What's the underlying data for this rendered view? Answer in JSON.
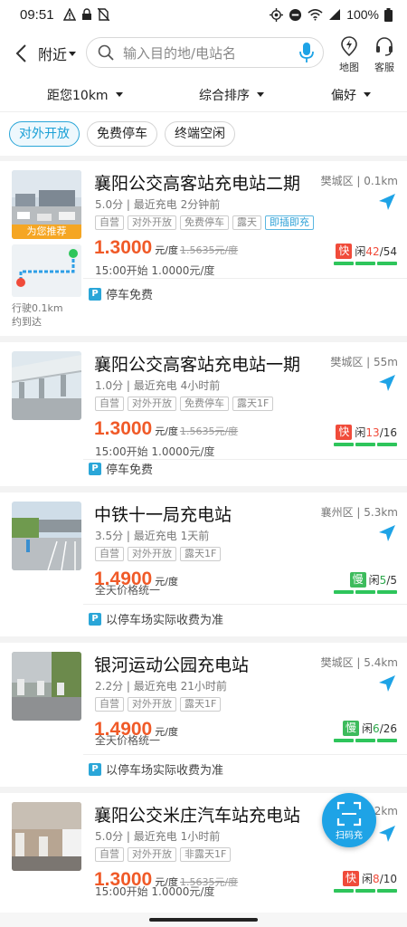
{
  "status_bar": {
    "time": "09:51",
    "battery": "100%"
  },
  "header": {
    "location": "附近",
    "search_placeholder": "输入目的地/电站名",
    "map_label": "地图",
    "service_label": "客服"
  },
  "filters": {
    "distance": "距您10km",
    "sort": "综合排序",
    "preference": "偏好"
  },
  "chips": [
    "对外开放",
    "免费停车",
    "终端空闲"
  ],
  "recommend_badge": "为您推荐",
  "drive_info": {
    "line1": "行驶0.1km",
    "line2": "约到达"
  },
  "stations": [
    {
      "name": "襄阳公交高客站充电站二期",
      "meta": "5.0分 | 最近充电 2分钟前",
      "distance": "樊城区 | 0.1km",
      "tags": [
        "自营",
        "对外开放",
        "免费停车",
        "露天",
        "即插即充"
      ],
      "price": "1.3000",
      "unit": "元/度",
      "old_price": "1.5635元/度",
      "sub": "15:00开始 1.0000元/度",
      "charger_type": "快",
      "free_label": "闲",
      "free": "42",
      "total": "/54",
      "parking": "停车免费"
    },
    {
      "name": "襄阳公交高客站充电站一期",
      "meta": "1.0分 | 最近充电 4小时前",
      "distance": "樊城区 | 55m",
      "tags": [
        "自营",
        "对外开放",
        "免费停车",
        "露天1F"
      ],
      "price": "1.3000",
      "unit": "元/度",
      "old_price": "1.5635元/度",
      "sub": "15:00开始 1.0000元/度",
      "charger_type": "快",
      "free_label": "闲",
      "free": "13",
      "total": "/16",
      "parking": "停车免费"
    },
    {
      "name": "中铁十一局充电站",
      "meta": "3.5分 | 最近充电 1天前",
      "distance": "襄州区 | 5.3km",
      "tags": [
        "自营",
        "对外开放",
        "露天1F"
      ],
      "price": "1.4900",
      "unit": "元/度",
      "old_price": "",
      "sub": "全天价格统一",
      "charger_type": "慢",
      "free_label": "闲",
      "free": "5",
      "total": "/5",
      "parking": "以停车场实际收费为准"
    },
    {
      "name": "银河运动公园充电站",
      "meta": "2.2分 | 最近充电 21小时前",
      "distance": "樊城区 | 5.4km",
      "tags": [
        "自营",
        "对外开放",
        "露天1F"
      ],
      "price": "1.4900",
      "unit": "元/度",
      "old_price": "",
      "sub": "全天价格统一",
      "charger_type": "慢",
      "free_label": "闲",
      "free": "6",
      "total": "/26",
      "parking": "以停车场实际收费为准"
    },
    {
      "name": "襄阳公交米庄汽车站充电站",
      "meta": "5.0分 | 最近充电 1小时前",
      "distance": "6.2km",
      "tags": [
        "自营",
        "对外开放",
        "非露天1F"
      ],
      "price": "1.3000",
      "unit": "元/度",
      "old_price": "1.5635元/度",
      "sub": "15:00开始 1.0000元/度",
      "charger_type": "快",
      "free_label": "闲",
      "free": "8",
      "total": "/10",
      "parking": ""
    }
  ],
  "scan_button": "扫码充",
  "colors": {
    "accent": "#1ea3e6",
    "price": "#f05a28",
    "fast": "#f04b3a",
    "slow": "#3dbb5c"
  }
}
